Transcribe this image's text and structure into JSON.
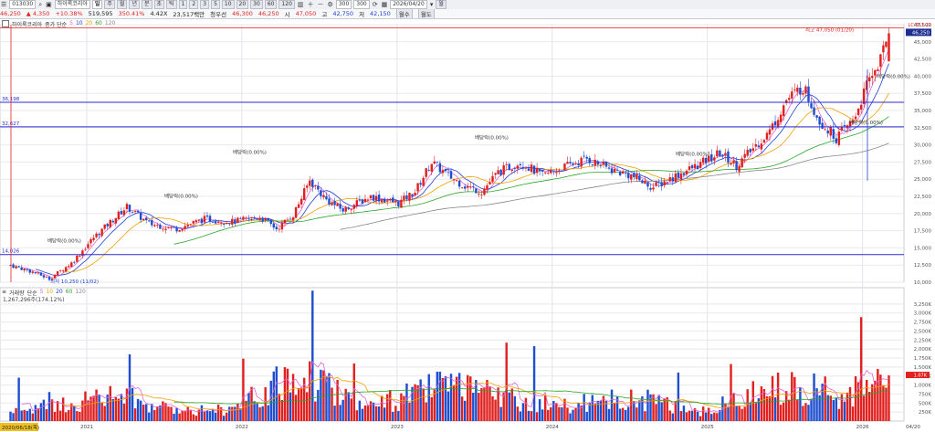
{
  "toolbar": {
    "code": "013030",
    "name": "하이록코리아",
    "periods": [
      "일",
      "주",
      "월",
      "년",
      "분",
      "초",
      "틱"
    ],
    "intervals": [
      "1",
      "2",
      "3",
      "5",
      "10",
      "20",
      "30",
      "60",
      "120"
    ],
    "count": "300",
    "count_total": "300",
    "date": "2026/04/20",
    "extra_btn": "월",
    "icon_names": [
      "search-icon",
      "lock-icon",
      "zoom-in-icon",
      "zoom-out-icon",
      "settings-icon",
      "calendar-icon"
    ]
  },
  "quote": {
    "price": "46,250",
    "change": "4,350",
    "change_pct": "+10.38%",
    "volume": "519,595",
    "turnover": "350.41%",
    "rate": "4.42X",
    "amount": "23,517백만",
    "order": "청우선",
    "open_label": "시",
    "open_val": "46,300",
    "open_val2": "46,250",
    "high_label": "고",
    "high_val": "47,050",
    "low_label": "저",
    "low_val": "42,750",
    "close_label": "종",
    "close_val": "42,150",
    "btn_label": "월수",
    "btn2_label": "월도"
  },
  "legend_price": {
    "name": "하이록코리아",
    "ma_label": "종가 단순",
    "ma": [
      "5",
      "10",
      "20",
      "60",
      "120"
    ]
  },
  "legend_vol": {
    "name": "거래량",
    "ma_label": "단순",
    "ma": [
      "5",
      "10",
      "20",
      "60",
      "120"
    ]
  },
  "vol_stat": "1,267,296주(174.12%)",
  "annotations": {
    "high": "최고 47,050 (01/20)",
    "low": "최저 10,250 (11/02)",
    "div": "배당락(0.00%)",
    "div2": "배당락(0.00%)",
    "div3": "배당락(0.00%)",
    "div4": "배당락(0.00%)",
    "div5": "배당락(0.00%)",
    "div6": "배당락(0.00%)",
    "div7": "배당락(0.00%)",
    "div8": "배당락(0.00%)",
    "hline1": "36,198",
    "hline2": "32,627",
    "hline3": "14,026",
    "date_badge": "2020/06/18(목)",
    "tag_current": "46,250",
    "tag_red": "LC:351.22",
    "vol_tag": "1.07K"
  },
  "colors": {
    "up": "#e0211f",
    "down": "#1f4fcf",
    "ma5": "#e066d6",
    "ma10": "#1f3fd6",
    "ma20": "#f0a000",
    "ma60": "#2aa52a",
    "ma120": "#888888",
    "hline": "#2b2bd6",
    "grid": "#e8e8ee"
  },
  "chart_data": {
    "type": "candlestick",
    "price_axis": {
      "ylim": [
        10000,
        47050
      ],
      "ticks": [
        "47,500",
        "45,000",
        "42,500",
        "40,000",
        "37,500",
        "35,000",
        "32,500",
        "30,000",
        "27,500",
        "25,000",
        "22,500",
        "20,000",
        "17,500",
        "15,000",
        "12,500",
        "10,000"
      ]
    },
    "volume_axis": {
      "ylim": [
        0,
        3500000
      ],
      "ticks": [
        "3,250K",
        "3,000K",
        "2,750K",
        "2,500K",
        "2,250K",
        "2,000K",
        "1,750K",
        "1,500K",
        "1,250K",
        "1,000K",
        "750K",
        "500K",
        "250K"
      ]
    },
    "x_labels": [
      "2021",
      "2022",
      "2023",
      "2024",
      "2025",
      "2026",
      "04/20"
    ],
    "anchors": [
      [
        0,
        12500
      ],
      [
        8,
        11500
      ],
      [
        14,
        10500
      ],
      [
        22,
        12800
      ],
      [
        30,
        16500
      ],
      [
        42,
        21000
      ],
      [
        50,
        18500
      ],
      [
        60,
        17800
      ],
      [
        70,
        19200
      ],
      [
        80,
        18800
      ],
      [
        90,
        19500
      ],
      [
        96,
        17800
      ],
      [
        102,
        19800
      ],
      [
        108,
        24800
      ],
      [
        114,
        22000
      ],
      [
        120,
        20500
      ],
      [
        130,
        22500
      ],
      [
        140,
        21500
      ],
      [
        146,
        23200
      ],
      [
        152,
        27500
      ],
      [
        158,
        25500
      ],
      [
        164,
        24000
      ],
      [
        170,
        23200
      ],
      [
        176,
        26000
      ],
      [
        184,
        27500
      ],
      [
        192,
        25500
      ],
      [
        200,
        26800
      ],
      [
        208,
        28000
      ],
      [
        216,
        26500
      ],
      [
        224,
        25500
      ],
      [
        232,
        23800
      ],
      [
        240,
        25500
      ],
      [
        248,
        27000
      ],
      [
        256,
        28800
      ],
      [
        262,
        27000
      ],
      [
        268,
        29500
      ],
      [
        274,
        32000
      ],
      [
        280,
        36500
      ],
      [
        286,
        38500
      ],
      [
        292,
        33500
      ],
      [
        298,
        31000
      ],
      [
        304,
        33500
      ],
      [
        310,
        39500
      ],
      [
        314,
        42500
      ],
      [
        317,
        46250
      ]
    ],
    "volume_anchors": [
      [
        0,
        350000
      ],
      [
        20,
        600000
      ],
      [
        40,
        900000
      ],
      [
        55,
        450000
      ],
      [
        80,
        400000
      ],
      [
        105,
        1700000
      ],
      [
        130,
        500000
      ],
      [
        155,
        1200000
      ],
      [
        200,
        500000
      ],
      [
        225,
        800000
      ],
      [
        250,
        350000
      ],
      [
        280,
        1300000
      ],
      [
        300,
        900000
      ],
      [
        317,
        1267296
      ]
    ],
    "bars": 318
  }
}
